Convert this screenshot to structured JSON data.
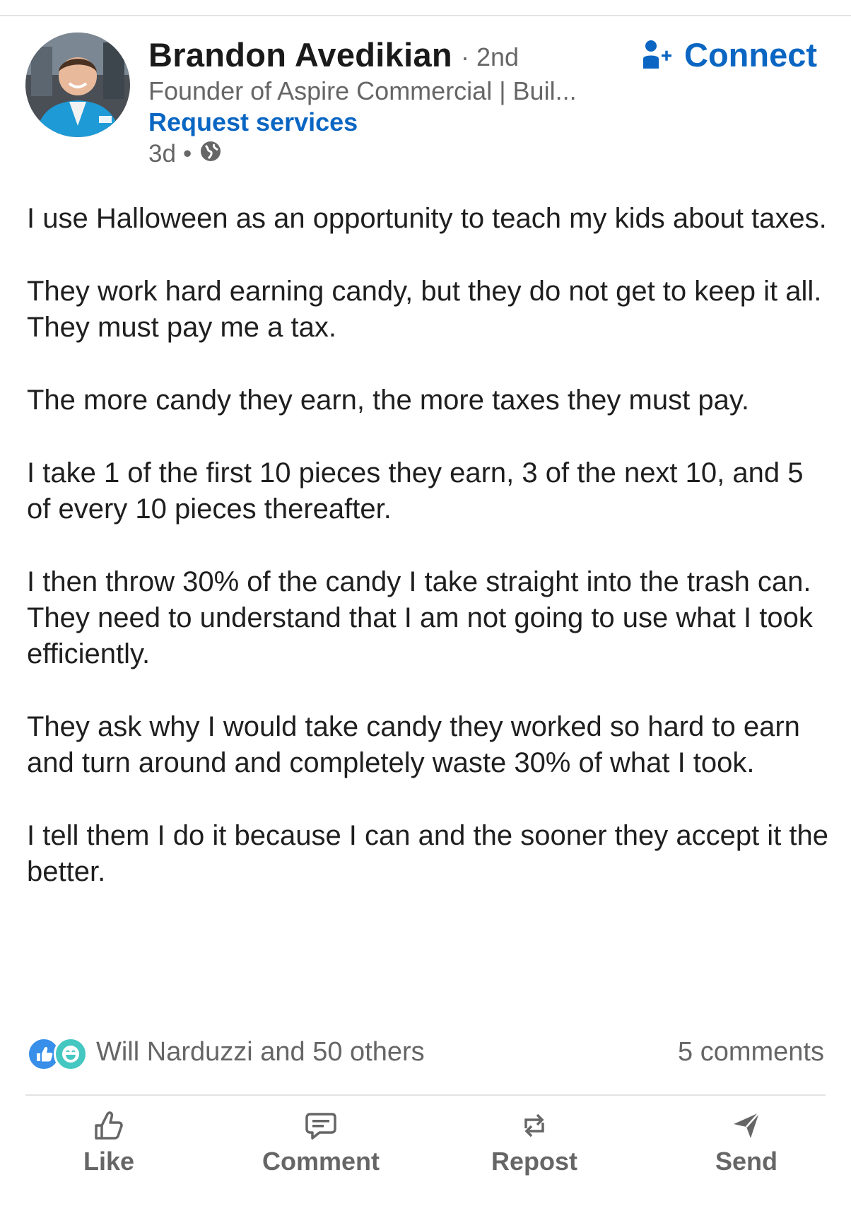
{
  "post": {
    "author": {
      "name": "Brandon Avedikian",
      "degree": "· 2nd",
      "headline": "Founder of Aspire Commercial | Buil...",
      "request_link": "Request services",
      "time": "3d",
      "separator": "•",
      "visibility_icon": "globe-icon"
    },
    "connect": {
      "label": "Connect",
      "icon": "add-person-icon",
      "color": "#0a66c2"
    },
    "paragraphs": [
      "I use Halloween as an opportunity to teach my kids about taxes.",
      "They work hard earning candy, but they do not get to keep it all. They must pay me a tax.",
      "The more candy they earn, the more taxes they must pay.",
      "I take 1 of the first 10 pieces they earn, 3 of the next 10, and 5 of every 10 pieces thereafter.",
      "I then throw 30% of the candy I take straight into the trash can. They need to understand that I am not going to use what I took efficiently.",
      "They ask why I would take candy they worked so hard to earn and turn around and completely waste 30% of what I took.",
      "I tell them I do it because I can and the sooner they accept it the better."
    ],
    "social": {
      "reactions_text": "Will Narduzzi and 50 others",
      "reaction_icons": [
        "like-reaction-icon",
        "funny-reaction-icon"
      ],
      "comments_text": "5 comments"
    },
    "actions": [
      {
        "label": "Like",
        "icon": "like-icon"
      },
      {
        "label": "Comment",
        "icon": "comment-icon"
      },
      {
        "label": "Repost",
        "icon": "repost-icon"
      },
      {
        "label": "Send",
        "icon": "send-icon"
      }
    ]
  },
  "colors": {
    "brand_blue": "#0a66c2",
    "muted_text": "#666666",
    "body_text": "#1f1f1f"
  }
}
